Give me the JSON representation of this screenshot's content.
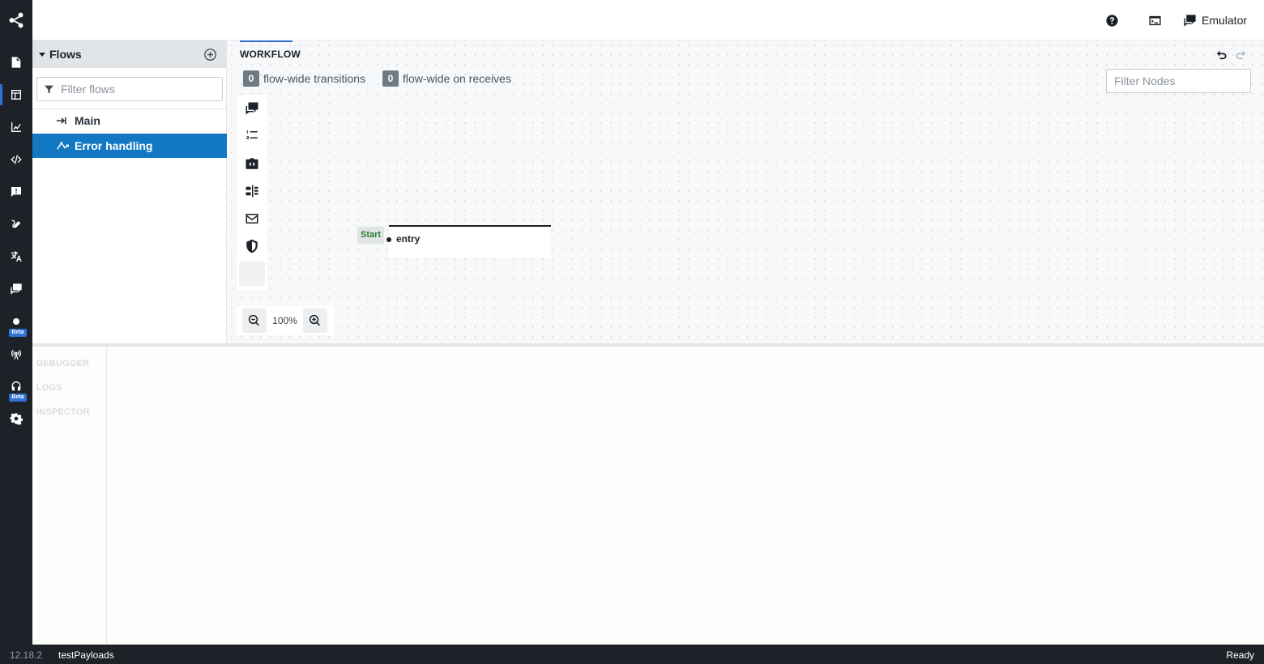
{
  "topbar": {
    "help_icon": "help-circle-icon",
    "terminal_icon": "terminal-icon",
    "emulator_label": "Emulator"
  },
  "flows": {
    "title": "Flows",
    "filter_placeholder": "Filter flows",
    "items": [
      {
        "label": "Main",
        "icon": "main-flow-icon",
        "selected": false
      },
      {
        "label": "Error handling",
        "icon": "error-flow-icon",
        "selected": true
      }
    ]
  },
  "workflow": {
    "tab_label": "WORKFLOW",
    "transitions_count": "0",
    "transitions_label": "flow-wide transitions",
    "receives_count": "0",
    "receives_label": "flow-wide on receives",
    "filter_nodes_placeholder": "Filter Nodes",
    "zoom_level": "100%",
    "start_label": "Start",
    "node_name": "entry"
  },
  "bottom": {
    "tabs": [
      "DEBUGGER",
      "LOGS",
      "INSPECTOR"
    ]
  },
  "rail": {
    "beta_label": "Beta"
  },
  "status": {
    "version": "12.18.2",
    "workspace": "testPayloads",
    "state": "Ready"
  },
  "colors": {
    "rail_bg": "#1d2228",
    "accent": "#2d73d4",
    "selected_flow": "#1278c4",
    "start_green": "#2e7d32"
  }
}
